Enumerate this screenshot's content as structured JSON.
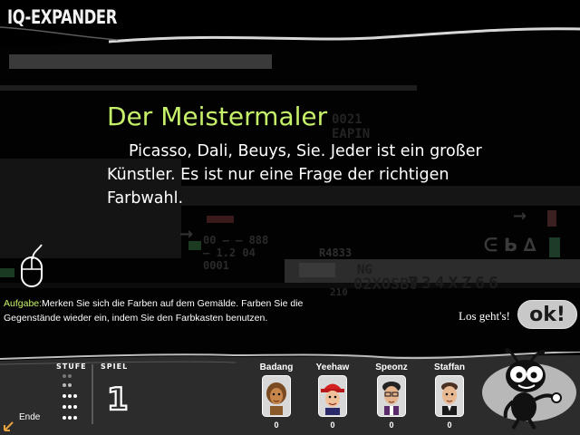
{
  "app": {
    "logo": "IQ-EXPANDER"
  },
  "screen": {
    "title": "Der Meistermaler",
    "body": "Picasso, Dali, Beuys, Sie. Jeder ist ein großer Künstler. Es ist nur eine Frage der richtigen Farbwahl.",
    "task_label": "Aufgabe:",
    "task_text": "Merken Sie sich die Farben auf dem Gemälde. Farben Sie die Gegenstände wieder ein, indem Sie den Farbkasten benutzen.",
    "go_label": "Los geht's!",
    "ok_label": "ok!"
  },
  "bottom": {
    "level_label": "STUFE",
    "game_label": "SPIEL",
    "game_number": "1",
    "end_label": "Ende",
    "players": [
      {
        "name": "Badang",
        "score": "0"
      },
      {
        "name": "Yeehaw",
        "score": "0"
      },
      {
        "name": "Speonz",
        "score": "0"
      },
      {
        "name": "Staffan",
        "score": "0"
      }
    ]
  },
  "colors": {
    "accent_green": "#c6f06a",
    "panel_gray": "#c8c8c8",
    "background": "#020202"
  },
  "icons": [
    "mouse-icon",
    "ant-mascot-icon",
    "corner-arrow-icon"
  ]
}
